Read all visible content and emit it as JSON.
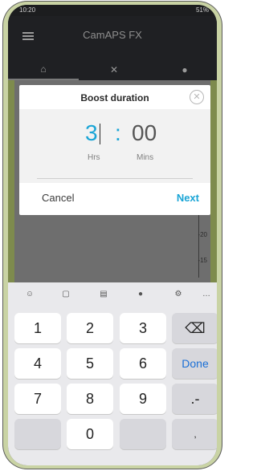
{
  "status_bar": {
    "time": "10:20",
    "right": "51%"
  },
  "app": {
    "title": "CamAPS FX"
  },
  "tabs": [
    {
      "icon": "home-icon",
      "glyph": "⌂"
    },
    {
      "icon": "tools-icon",
      "glyph": "✕"
    },
    {
      "icon": "drop-icon",
      "glyph": "●"
    }
  ],
  "chart": {
    "ticks": [
      "-20",
      "-15"
    ]
  },
  "dialog": {
    "title": "Boost duration",
    "hours": "3",
    "separator": ":",
    "minutes": "00",
    "hours_label": "Hrs",
    "minutes_label": "Mins",
    "cancel_label": "Cancel",
    "next_label": "Next"
  },
  "keyboard": {
    "toolbar": [
      "emoji-icon",
      "clipboard-icon",
      "text-edit-icon",
      "mic-icon",
      "settings-icon",
      "more-icon"
    ],
    "keys": {
      "k1": "1",
      "k2": "2",
      "k3": "3",
      "k4": "4",
      "k5": "5",
      "k6": "6",
      "k7": "7",
      "k8": "8",
      "k9": "9",
      "k0": "0",
      "done": "Done",
      "dot_dash": ".-",
      "comma": ","
    }
  },
  "colors": {
    "accent": "#1aa5d6",
    "done": "#1a6fd6"
  }
}
